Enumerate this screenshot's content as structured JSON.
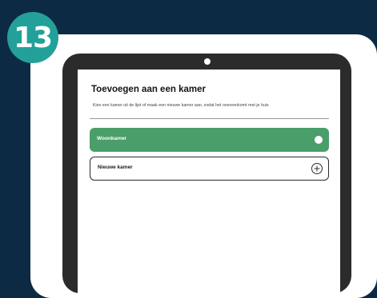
{
  "step": {
    "number": "13"
  },
  "screen": {
    "title": "Toevoegen aan een kamer",
    "subtitle": "Kies een kamer uit de lijst of maak een nieuwe kamer aan, zodat het overeenkomt met je huis"
  },
  "rooms": {
    "items": [
      {
        "label": "Woonkamer",
        "selected": true,
        "icon": "selected-dot-icon"
      },
      {
        "label": "Nieuwe kamer",
        "selected": false,
        "icon": "plus-circle-icon"
      }
    ]
  },
  "colors": {
    "background": "#0c2a44",
    "badge": "#24a09a",
    "selected_room": "#4a9e6a",
    "tablet_frame": "#2b2b2b"
  }
}
